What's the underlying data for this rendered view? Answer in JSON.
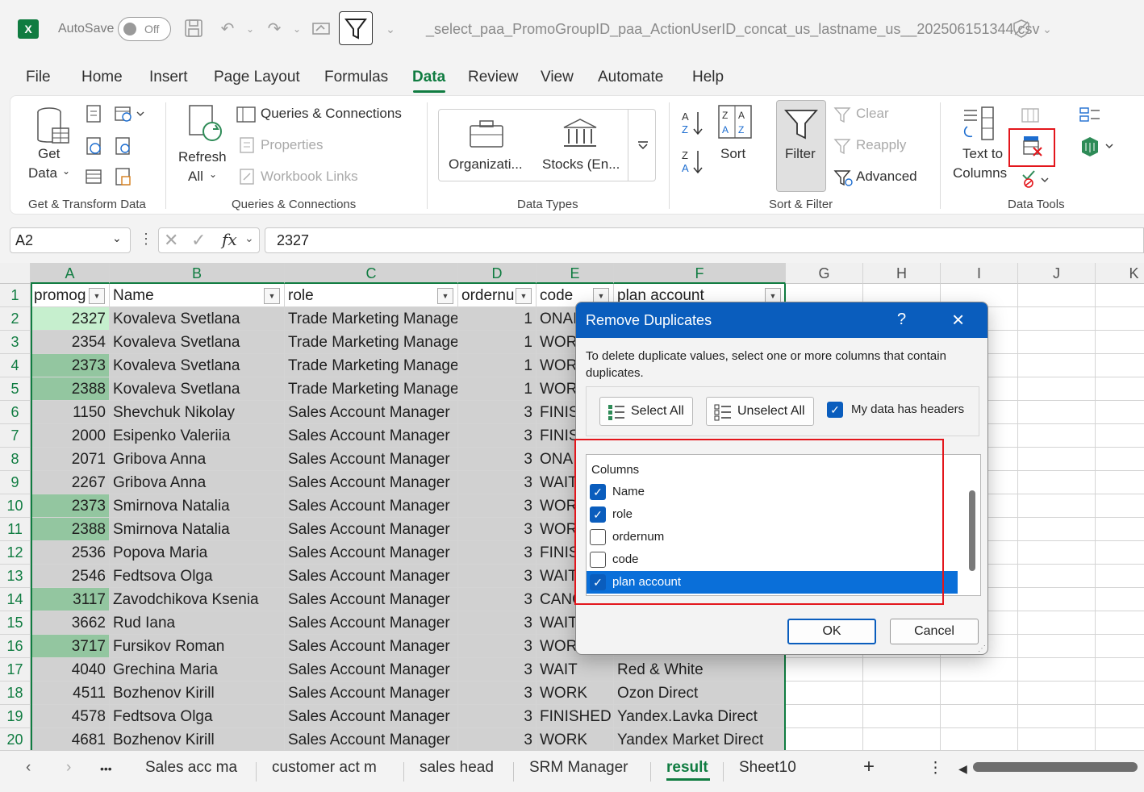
{
  "titlebar": {
    "autosave_label": "AutoSave",
    "autosave_state": "Off",
    "document_title": "_select_paa_PromoGroupID_paa_ActionUserID_concat_us_lastname_us__202506151344.csv"
  },
  "menu": [
    "File",
    "Home",
    "Insert",
    "Page Layout",
    "Formulas",
    "Data",
    "Review",
    "View",
    "Automate",
    "Help"
  ],
  "menu_active": "Data",
  "ribbon": {
    "get_data": "Get",
    "get_data2": "Data",
    "refresh": "Refresh",
    "refresh2": "All",
    "queries_connections": "Queries & Connections",
    "properties": "Properties",
    "workbook_links": "Workbook Links",
    "organization": "Organizati...",
    "stocks": "Stocks (En...",
    "sort": "Sort",
    "filter": "Filter",
    "clear": "Clear",
    "reapply": "Reapply",
    "advanced": "Advanced",
    "text_to_columns": "Text to",
    "text_to_columns2": "Columns",
    "groups": {
      "get_transform": "Get & Transform Data",
      "queries": "Queries & Connections",
      "data_types": "Data Types",
      "sort_filter": "Sort & Filter",
      "data_tools": "Data Tools"
    }
  },
  "formula_bar": {
    "name_box": "A2",
    "fx": "fx",
    "value": "2327"
  },
  "grid": {
    "columns": [
      "A",
      "B",
      "C",
      "D",
      "E",
      "F",
      "G",
      "H",
      "I",
      "J",
      "K"
    ],
    "headers": [
      "promog",
      "Name",
      "role",
      "ordernu",
      "code",
      "plan account"
    ],
    "rows": [
      {
        "n": "2",
        "a": "2327",
        "b": "Kovaleva Svetlana",
        "c": "Trade Marketing Manage",
        "d": "1",
        "e": "ONAI",
        "f": ""
      },
      {
        "n": "3",
        "a": "2354",
        "b": "Kovaleva Svetlana",
        "c": "Trade Marketing Manage",
        "d": "1",
        "e": "WOR",
        "f": ""
      },
      {
        "n": "4",
        "a": "2373",
        "b": "Kovaleva Svetlana",
        "c": "Trade Marketing Manage",
        "d": "1",
        "e": "WOR",
        "f": ""
      },
      {
        "n": "5",
        "a": "2388",
        "b": "Kovaleva Svetlana",
        "c": "Trade Marketing Manage",
        "d": "1",
        "e": "WOR",
        "f": ""
      },
      {
        "n": "6",
        "a": "1150",
        "b": "Shevchuk Nikolay",
        "c": "Sales Account Manager",
        "d": "3",
        "e": "FINIS",
        "f": ""
      },
      {
        "n": "7",
        "a": "2000",
        "b": "Esipenko Valeriia",
        "c": "Sales Account Manager",
        "d": "3",
        "e": "FINIS",
        "f": ""
      },
      {
        "n": "8",
        "a": "2071",
        "b": "Gribova Anna",
        "c": "Sales Account Manager",
        "d": "3",
        "e": "ONA",
        "f": ""
      },
      {
        "n": "9",
        "a": "2267",
        "b": "Gribova Anna",
        "c": "Sales Account Manager",
        "d": "3",
        "e": "WAIT",
        "f": ""
      },
      {
        "n": "10",
        "a": "2373",
        "b": "Smirnova Natalia",
        "c": "Sales Account Manager",
        "d": "3",
        "e": "WOR",
        "f": ""
      },
      {
        "n": "11",
        "a": "2388",
        "b": "Smirnova Natalia",
        "c": "Sales Account Manager",
        "d": "3",
        "e": "WOR",
        "f": ""
      },
      {
        "n": "12",
        "a": "2536",
        "b": "Popova Maria",
        "c": "Sales Account Manager",
        "d": "3",
        "e": "FINIS",
        "f": ""
      },
      {
        "n": "13",
        "a": "2546",
        "b": "Fedtsova Olga",
        "c": "Sales Account Manager",
        "d": "3",
        "e": "WAIT",
        "f": ""
      },
      {
        "n": "14",
        "a": "3117",
        "b": "Zavodchikova Ksenia",
        "c": "Sales Account Manager",
        "d": "3",
        "e": "CANC",
        "f": ""
      },
      {
        "n": "15",
        "a": "3662",
        "b": "Rud Iana",
        "c": "Sales Account Manager",
        "d": "3",
        "e": "WAIT",
        "f": ""
      },
      {
        "n": "16",
        "a": "3717",
        "b": "Fursikov Roman",
        "c": "Sales Account Manager",
        "d": "3",
        "e": "WOR",
        "f": ""
      },
      {
        "n": "17",
        "a": "4040",
        "b": "Grechina Maria",
        "c": "Sales Account Manager",
        "d": "3",
        "e": "WAIT",
        "f": "Red & White"
      },
      {
        "n": "18",
        "a": "4511",
        "b": "Bozhenov Kirill",
        "c": "Sales Account Manager",
        "d": "3",
        "e": "WORK",
        "f": "Ozon Direct"
      },
      {
        "n": "19",
        "a": "4578",
        "b": "Fedtsova Olga",
        "c": "Sales Account Manager",
        "d": "3",
        "e": "FINISHED",
        "f": "Yandex.Lavka Direct"
      },
      {
        "n": "20",
        "a": "4681",
        "b": "Bozhenov Kirill",
        "c": "Sales Account Manager",
        "d": "3",
        "e": "WORK",
        "f": "Yandex Market Direct"
      }
    ]
  },
  "dialog": {
    "title": "Remove Duplicates",
    "help": "?",
    "description": "To delete duplicate values, select one or more columns that contain duplicates.",
    "select_all": "Select All",
    "unselect_all": "Unselect All",
    "headers_label": "My data has headers",
    "headers_checked": true,
    "columns_header": "Columns",
    "columns": [
      {
        "label": "Name",
        "checked": true
      },
      {
        "label": "role",
        "checked": true
      },
      {
        "label": "ordernum",
        "checked": false
      },
      {
        "label": "code",
        "checked": false
      },
      {
        "label": "plan account",
        "checked": true
      }
    ],
    "ok": "OK",
    "cancel": "Cancel"
  },
  "sheets": {
    "tabs": [
      "Sales acc ma",
      "customer act m",
      "sales head",
      "SRM Manager",
      "result",
      "Sheet10"
    ],
    "active": "result",
    "more": "•••",
    "add": "+"
  },
  "colors": {
    "excel_green": "#107c41",
    "dialog_blue": "#0a5dbd",
    "highlight_red": "#e3161c",
    "duplicate_green": "#93c6a0"
  }
}
